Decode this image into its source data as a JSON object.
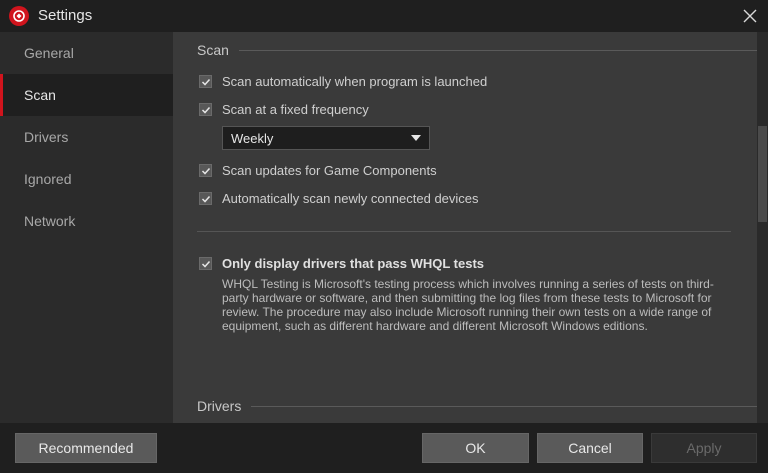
{
  "window": {
    "title": "Settings"
  },
  "sidebar": {
    "items": [
      {
        "label": "General"
      },
      {
        "label": "Scan"
      },
      {
        "label": "Drivers"
      },
      {
        "label": "Ignored"
      },
      {
        "label": "Network"
      }
    ],
    "active": "Scan"
  },
  "scan": {
    "section_title": "Scan",
    "auto_launch": "Scan automatically when program is launched",
    "fixed_frequency": "Scan at a fixed frequency",
    "frequency_value": "Weekly",
    "game_components": "Scan updates for Game Components",
    "new_devices": "Automatically scan newly connected devices",
    "whql_label": "Only display drivers that pass WHQL tests",
    "whql_description": "WHQL Testing is Microsoft's testing process which involves running a series of tests on third-party hardware or software, and then submitting the log files from these tests to Microsoft for review. The procedure may also include Microsoft running their own tests on a wide range of equipment, such as different hardware and different Microsoft Windows editions."
  },
  "drivers": {
    "section_title": "Drivers"
  },
  "footer": {
    "recommended": "Recommended",
    "ok": "OK",
    "cancel": "Cancel",
    "apply": "Apply"
  },
  "colors": {
    "accent": "#d0141d",
    "background": "#1f1f1f",
    "panel": "#3a3a3a",
    "sidebar": "#2b2b2b"
  }
}
